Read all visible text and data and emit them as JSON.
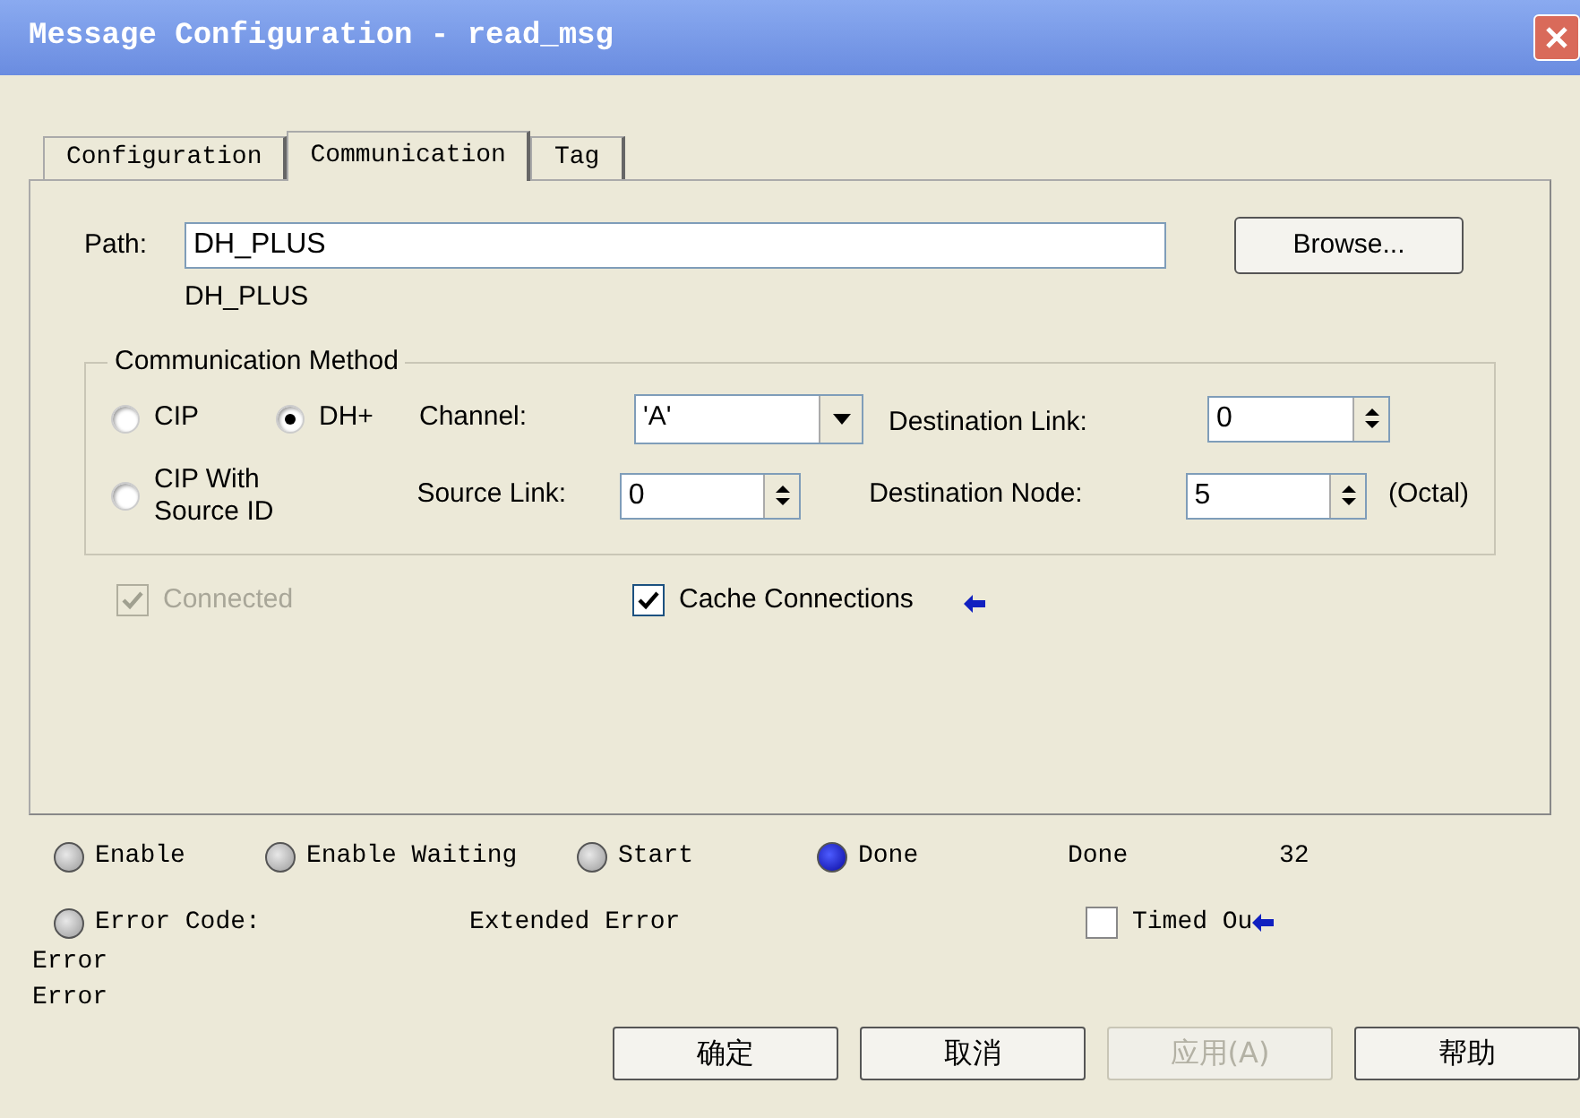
{
  "window": {
    "title": "Message Configuration - read_msg"
  },
  "tabs": [
    {
      "label": "Configuration",
      "selected": false
    },
    {
      "label": "Communication",
      "selected": true
    },
    {
      "label": "Tag",
      "selected": false
    }
  ],
  "path": {
    "label": "Path:",
    "value": "DH_PLUS",
    "resolved": "DH_PLUS",
    "browse": "Browse..."
  },
  "method": {
    "title": "Communication Method",
    "radios": [
      {
        "label": "CIP",
        "selected": false
      },
      {
        "label": "DH+",
        "selected": true
      },
      {
        "label": "CIP With Source ID",
        "selected": false
      }
    ],
    "channel": {
      "label": "Channel:",
      "value": "'A'"
    },
    "source_link": {
      "label": "Source Link:",
      "value": "0"
    },
    "destination_link": {
      "label": "Destination Link:",
      "value": "0"
    },
    "destination_node": {
      "label": "Destination Node:",
      "value": "5",
      "unit": "(Octal)"
    }
  },
  "connected": {
    "label": "Connected",
    "checked": true,
    "disabled": true
  },
  "cache": {
    "label": "Cache Connections",
    "checked": true,
    "disabled": false
  },
  "status": {
    "lights": [
      {
        "label": "Enable",
        "on": false
      },
      {
        "label": "Enable Waiting",
        "on": false
      },
      {
        "label": "Start",
        "on": false
      },
      {
        "label": "Done",
        "on": true
      }
    ],
    "done_label": "Done",
    "done_value": "32",
    "error_code": {
      "label": "Error Code:",
      "on": false
    },
    "extended_error": "Extended Error",
    "timed_out": {
      "label": "Timed Ou",
      "checked": false
    },
    "errors": [
      "Error",
      "Error"
    ]
  },
  "buttons": [
    {
      "label": "确定",
      "disabled": false
    },
    {
      "label": "取消",
      "disabled": false
    },
    {
      "label": "应用(A)",
      "disabled": true
    },
    {
      "label": "帮助",
      "disabled": false
    }
  ]
}
